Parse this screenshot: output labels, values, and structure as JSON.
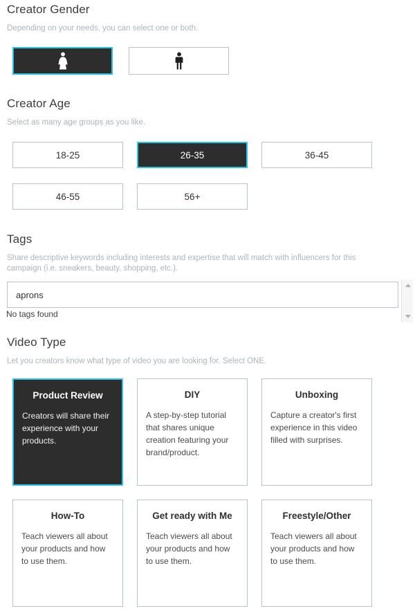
{
  "gender_section": {
    "title": "Creator Gender",
    "description": "Depending on your needs, you can select one or both.",
    "options": [
      {
        "id": "female",
        "icon": "female-gender-icon",
        "selected": true
      },
      {
        "id": "male",
        "icon": "male-gender-icon",
        "selected": false
      }
    ]
  },
  "age_section": {
    "title": "Creator Age",
    "description": "Select as many age groups as you like.",
    "options": [
      {
        "label": "18-25",
        "selected": false
      },
      {
        "label": "26-35",
        "selected": true
      },
      {
        "label": "36-45",
        "selected": false
      },
      {
        "label": "46-55",
        "selected": false
      },
      {
        "label": "56+",
        "selected": false
      }
    ]
  },
  "tags_section": {
    "title": "Tags",
    "description": "Share descriptive keywords including interests and expertise that will match with influencers for this campaign (i.e. sneakers, beauty, shopping, etc.).",
    "input_value": "aprons",
    "input_placeholder": "",
    "status_text": "No tags found",
    "scrollbar": {
      "up_icon": "chevron-up-icon",
      "down_icon": "chevron-down-icon"
    }
  },
  "video_type_section": {
    "title": "Video Type",
    "description": "Let you creators know what type of video you are looking for. Select ONE.",
    "cards": [
      {
        "title": "Product Review",
        "description": "Creators will share their experience with your products.",
        "selected": true
      },
      {
        "title": "DIY",
        "description": "A step-by-step tutorial that shares unique creation featuring your brand/product.",
        "selected": false
      },
      {
        "title": "Unboxing",
        "description": "Capture a creator's first experience in this video filled with surprises.",
        "selected": false
      },
      {
        "title": "How-To",
        "description": "Teach viewers all about your products and how to use them.",
        "selected": false
      },
      {
        "title": "Get ready with Me",
        "description": "Teach viewers all about your products and how to use them.",
        "selected": false
      },
      {
        "title": "Freestyle/Other",
        "description": "Teach viewers all about your products and how to use them.",
        "selected": false
      }
    ]
  },
  "colors": {
    "accent": "#27c3e4",
    "selected_fill": "#2d2d2d",
    "border": "#b7c5ca",
    "heading": "#3d3d3d",
    "muted_text": "#a9b6bd"
  }
}
